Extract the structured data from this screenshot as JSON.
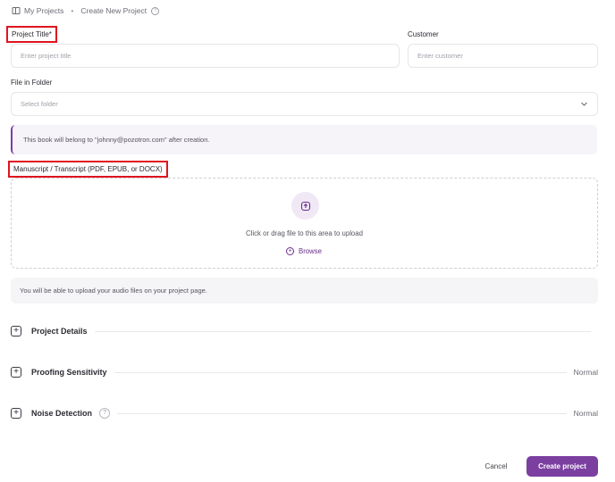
{
  "breadcrumb": {
    "projects": "My Projects",
    "separator": "•",
    "current": "Create New Project",
    "help_glyph": "?"
  },
  "form": {
    "title_label": "Project Title*",
    "title_placeholder": "Enter project title",
    "customer_label": "Customer",
    "customer_placeholder": "Enter customer",
    "folder_label": "File in Folder",
    "folder_placeholder": "Select folder"
  },
  "notice": "This book will belong to \"johnny@pozotron.com\" after creation.",
  "manuscript": {
    "label": "Manuscript / Transcript (PDF, EPUB, or DOCX)",
    "drop_text": "Click or drag file to this area to upload",
    "browse_label": "Browse"
  },
  "audio_info": "You will be able to upload your audio files on your project page.",
  "sections": [
    {
      "title": "Project Details",
      "value": ""
    },
    {
      "title": "Proofing Sensitivity",
      "value": "Normal"
    },
    {
      "title": "Noise Detection",
      "value": "Normal"
    }
  ],
  "actions": {
    "cancel": "Cancel",
    "create": "Create project"
  },
  "colors": {
    "accent": "#7b3fa0",
    "highlight": "#e0141e"
  },
  "icons": [
    "folder-icon",
    "help-icon",
    "chevron-down-icon",
    "upload-icon",
    "plus-circle-icon",
    "expand-icon"
  ]
}
